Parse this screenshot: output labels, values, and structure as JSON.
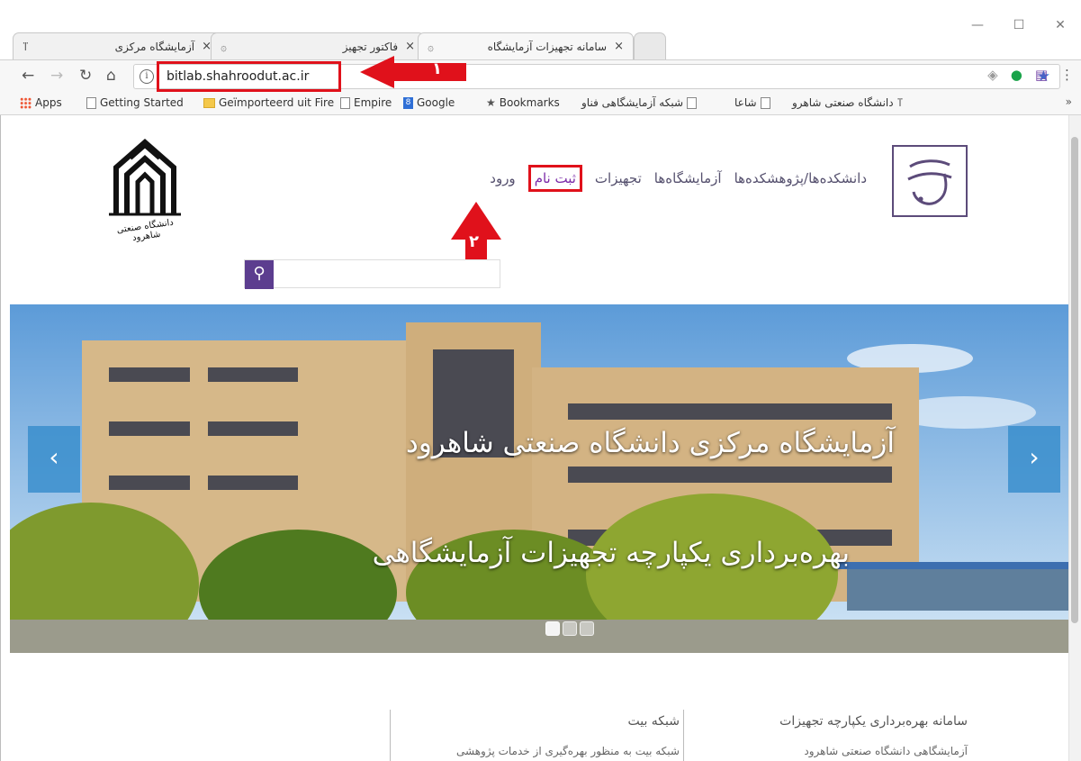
{
  "browser": {
    "tabs": [
      {
        "title": "آزمایشگاه مرکزی",
        "close": "×",
        "favicon": "ⴶ"
      },
      {
        "title": "فاکتور تجهیز",
        "close": "×",
        "favicon": "۞"
      },
      {
        "title": "سامانه تجهیزات آزمایشگاه",
        "close": "×",
        "favicon": "۞"
      }
    ],
    "window_controls": [
      "—",
      "☐",
      "✕"
    ],
    "url": "bitlab.shahroodut.ac.ir",
    "info_glyph": "i",
    "bookmarks": [
      {
        "label": "Apps",
        "icon": "apps-icon"
      },
      {
        "label": "Getting Started",
        "icon": "page-icon"
      },
      {
        "label": "Geïmporteerd uit Fire",
        "icon": "folder-icon"
      },
      {
        "label": "Empire",
        "icon": "page-icon"
      },
      {
        "label": "Google",
        "icon": "google-icon"
      },
      {
        "label": "Bookmarks",
        "icon": "star-icon"
      },
      {
        "label": "شبکه آزمایشگاهی فناو",
        "icon": "page-icon"
      },
      {
        "label": "شاعا",
        "icon": "uni-icon"
      },
      {
        "label": "دانشگاه صنعتی شاهرو",
        "icon": "uni-icon"
      }
    ],
    "bookmarks_more": "»"
  },
  "annotations": {
    "one": "١",
    "two": "٢"
  },
  "header": {
    "nav": [
      "دانشکده‌ها/پژوهشکده‌ها",
      "آزمایشگاه‌ها",
      "تجهیزات",
      "ثبت نام",
      "ورود"
    ],
    "search_placeholder": "",
    "search_glyph": "⚲",
    "university_logo_caption": "دانشگاه صنعتی شاهرود"
  },
  "slider": {
    "title": "آزمایشگاه مرکزی دانشگاه صنعتی شاهرود",
    "subtitle": "بهره‌برداری یکپارچه تجهیزات آزمایشگاهی",
    "prev": "‹",
    "next": "›",
    "dots": 3,
    "active_dot": 0
  },
  "bottom": {
    "col1_head": "سامانه بهره‌برداری یکپارچه تجهیزات",
    "col1_text": "آزمایشگاهی دانشگاه صنعتی شاهرود",
    "col2_head": "شبکه بیت",
    "col2_text": "شبکه بیت به منظور بهره‌گیری از خدمات پژوهشی"
  },
  "colors": {
    "annotation": "#e0111b",
    "brand": "#5c3d8f",
    "slider_arrow": "#3a8ecc"
  }
}
